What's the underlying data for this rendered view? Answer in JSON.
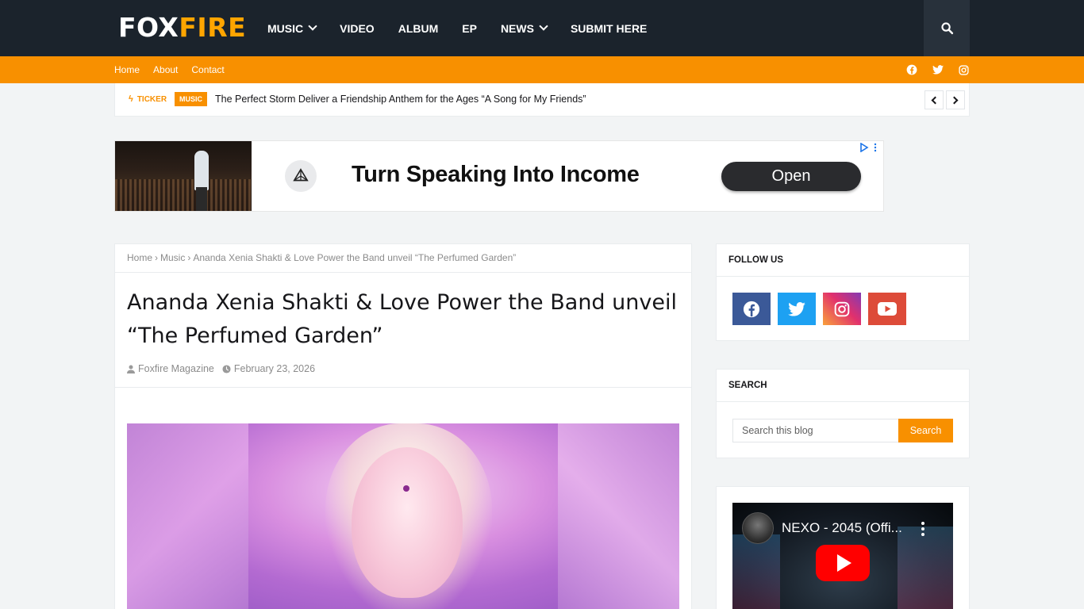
{
  "brand": {
    "logo_part1": "FOX",
    "logo_part2": "FIRE"
  },
  "main_nav": [
    {
      "label": "MUSIC",
      "dropdown": true
    },
    {
      "label": "VIDEO",
      "dropdown": false
    },
    {
      "label": "ALBUM",
      "dropdown": false
    },
    {
      "label": "EP",
      "dropdown": false
    },
    {
      "label": "NEWS",
      "dropdown": true
    },
    {
      "label": "SUBMIT HERE",
      "dropdown": false
    }
  ],
  "sub_nav": [
    "Home",
    "About",
    "Contact"
  ],
  "social_top": [
    "facebook-icon",
    "twitter-icon",
    "instagram-icon"
  ],
  "ticker": {
    "label": "TICKER",
    "tag": "MUSIC",
    "headline": "The Perfect Storm Deliver a Friendship Anthem for the Ages “A Song for My Friends”"
  },
  "ad": {
    "headline": "Turn Speaking Into Income",
    "button": "Open"
  },
  "breadcrumb": {
    "home": "Home",
    "category": "Music",
    "current": "Ananda Xenia Shakti & Love Power the Band unveil “The Perfumed Garden”",
    "separator": "›"
  },
  "post": {
    "title": "Ananda Xenia Shakti & Love Power the Band unveil “The Perfumed Garden”",
    "author": "Foxfire Magazine",
    "date": "February 23, 2026"
  },
  "widgets": {
    "follow": {
      "title": "FOLLOW US",
      "icons": [
        "facebook-icon",
        "twitter-icon",
        "instagram-icon",
        "youtube-icon"
      ]
    },
    "search": {
      "title": "SEARCH",
      "placeholder": "Search this blog",
      "button": "Search"
    },
    "video": {
      "title": "NEXO - 2045 (Offi..."
    }
  },
  "colors": {
    "header_bg": "#1b232c",
    "accent": "#f89000",
    "logo_accent": "#ffa500",
    "facebook": "#3b5998",
    "twitter": "#1da1f2",
    "youtube": "#dd4b39"
  }
}
